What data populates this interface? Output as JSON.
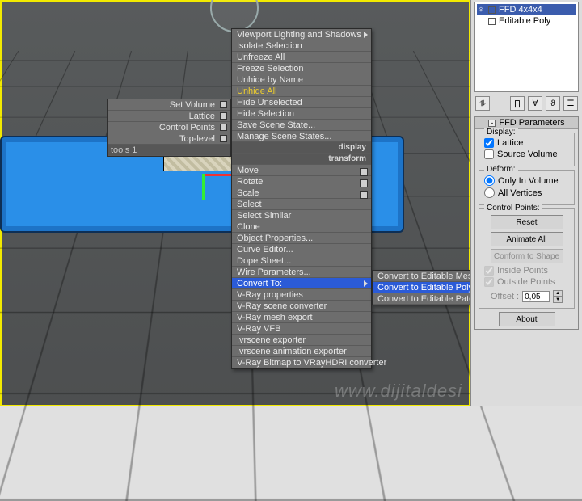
{
  "viewport": {
    "watermark": "www.dijitaldesi"
  },
  "quad": {
    "rows": [
      {
        "label": "Set Volume",
        "box": true
      },
      {
        "label": "Lattice",
        "box": true
      },
      {
        "label": "Control Points",
        "box": true
      },
      {
        "label": "Top-level",
        "box": true
      }
    ],
    "footer": "tools 1"
  },
  "menu_section1": [
    {
      "label": "Viewport Lighting and Shadows",
      "submenu": true
    },
    {
      "label": "Isolate Selection"
    },
    {
      "label": "Unfreeze All"
    },
    {
      "label": "Freeze Selection"
    },
    {
      "label": "Unhide by Name"
    },
    {
      "label": "Unhide All",
      "yellow": true
    },
    {
      "label": "Hide Unselected"
    },
    {
      "label": "Hide Selection"
    },
    {
      "label": "Save Scene State..."
    },
    {
      "label": "Manage Scene States..."
    }
  ],
  "menu_title1": "display",
  "menu_title2": "transform",
  "menu_section2": [
    {
      "label": "Move",
      "chk": true
    },
    {
      "label": "Rotate",
      "chk": true
    },
    {
      "label": "Scale",
      "chk": true
    },
    {
      "label": "Select"
    },
    {
      "label": "Select Similar"
    },
    {
      "label": "Clone"
    },
    {
      "label": "Object Properties..."
    },
    {
      "label": "Curve Editor..."
    },
    {
      "label": "Dope Sheet..."
    },
    {
      "label": "Wire Parameters..."
    },
    {
      "label": "Convert To:",
      "submenu": true,
      "hi": true
    },
    {
      "label": "V-Ray properties"
    },
    {
      "label": "V-Ray scene converter"
    },
    {
      "label": "V-Ray mesh export"
    },
    {
      "label": "V-Ray VFB"
    },
    {
      "label": ".vrscene exporter"
    },
    {
      "label": ".vrscene animation exporter"
    },
    {
      "label": "V-Ray Bitmap to VRayHDRI converter"
    }
  ],
  "flyout": [
    {
      "label": "Convert to Editable Mesh"
    },
    {
      "label": "Convert to Editable Poly",
      "hi": true
    },
    {
      "label": "Convert to Editable Patch"
    }
  ],
  "stack": {
    "rows": [
      {
        "label": "FFD 4x4x4",
        "sel": true,
        "bulb": "♀",
        "exp": "⊟"
      },
      {
        "label": "Editable Poly",
        "sel": false,
        "bulb": "",
        "exp": "■"
      }
    ]
  },
  "rollout": {
    "header": "FFD Parameters",
    "display": {
      "title": "Display:",
      "lattice": "Lattice",
      "lattice_chk": true,
      "source": "Source Volume",
      "source_chk": false
    },
    "deform": {
      "title": "Deform:",
      "only": "Only In Volume",
      "all": "All Vertices"
    },
    "cp": {
      "title": "Control Points:",
      "reset": "Reset",
      "animate": "Animate All",
      "conform": "Conform to Shape",
      "inside": "Inside Points",
      "outside": "Outside Points",
      "offset_label": "Offset :",
      "offset_value": "0,05"
    },
    "about": "About"
  }
}
